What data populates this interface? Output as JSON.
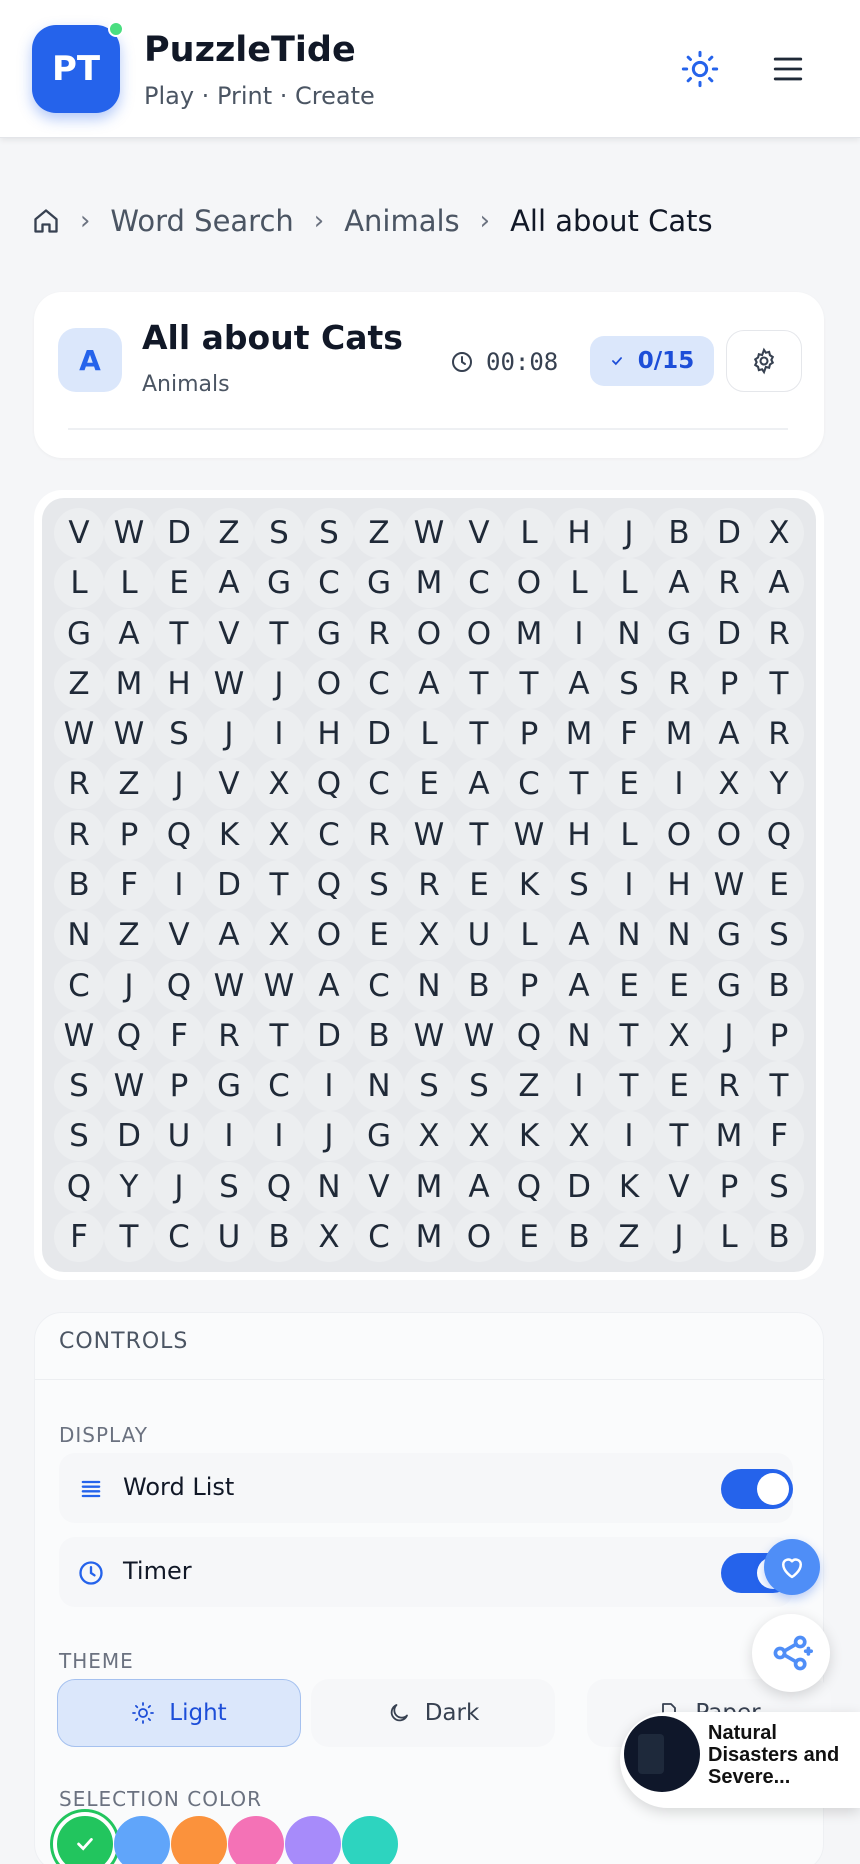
{
  "header": {
    "logo_text": "PT",
    "brand_name": "PuzzleTide",
    "tagline": "Play · Print · Create"
  },
  "breadcrumb": {
    "items": [
      "Word Search",
      "Animals",
      "All about Cats"
    ]
  },
  "puzzle": {
    "avatar_letter": "A",
    "title": "All about Cats",
    "category": "Animals",
    "timer": "00:08",
    "progress": "0/15"
  },
  "grid": [
    "VWDZSSZWVLHJBDX",
    "LLEAGCGMCOLLARA",
    "GATVTGROOMINGDR",
    "ZMHWJOCATTASRPT",
    "WWSJIHDLTPMFMAR",
    "RZJVXQCEACTEIXY",
    "RPQKXCRWTWHLOOQ",
    "BFIDTQSREKSIHWE",
    "NZVAXOEXULANNGS",
    "CJQWWACNBPAEEGB",
    "WQFRTDBWWQNTXJP",
    "SWPGCINSSZITERT",
    "SDUIIJGXXKXITMF",
    "QYJSQNVMAQDKVPS",
    "FTCUBXCMOEBZJLB"
  ],
  "controls": {
    "heading": "CONTROLS",
    "display_label": "DISPLAY",
    "word_list_label": "Word List",
    "timer_label": "Timer",
    "theme_label": "THEME",
    "theme_light": "Light",
    "theme_dark": "Dark",
    "theme_paper": "Paper",
    "selection_color_label": "SELECTION COLOR",
    "word_list_on": true,
    "timer_on": true
  },
  "swatches": [
    "#22c55e",
    "#60a5fa",
    "#fb923c",
    "#f472b6",
    "#a78bfa",
    "#2dd4bf"
  ],
  "promo": {
    "text": "Natural Disasters and Severe..."
  },
  "colors": {
    "accent": "#2563eb",
    "accent_soft": "#dbe7fb"
  }
}
